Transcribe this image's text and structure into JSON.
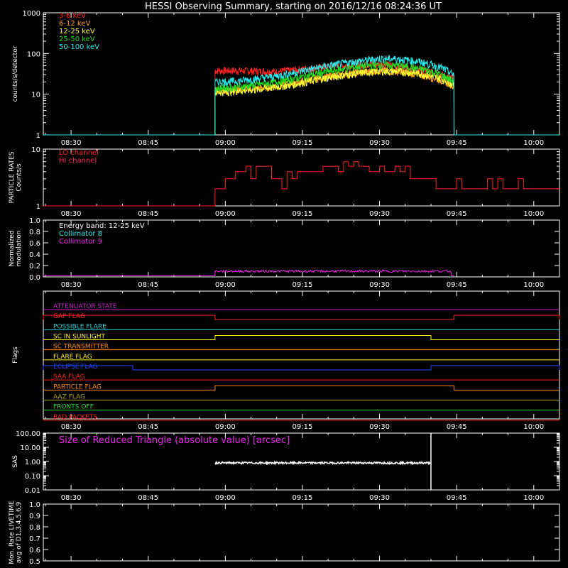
{
  "title": "HESSI Observing Summary, starting on 2016/12/16 08:24:36 UT",
  "x_tick_labels": [
    "08:30",
    "08:45",
    "09:00",
    "09:15",
    "09:30",
    "09:45",
    "10:00"
  ],
  "chart_data": [
    {
      "type": "line",
      "panel": "count-rates",
      "ylabel": "counts/s/detector",
      "yscale": "log",
      "ylim": [
        1,
        1000
      ],
      "ytick_labels": [
        "1",
        "10",
        "100",
        "1000"
      ],
      "xlim": [
        "08:24:36",
        "10:05:00"
      ],
      "data_interval": [
        "08:58:00",
        "09:44:30"
      ],
      "x": [
        "08:58",
        "09:02",
        "09:06",
        "09:10",
        "09:14",
        "09:18",
        "09:22",
        "09:26",
        "09:30",
        "09:34",
        "09:38",
        "09:42",
        "09:44"
      ],
      "series": [
        {
          "name": "3-6 keV",
          "color": "#ff2020",
          "values": [
            38,
            38,
            37,
            36,
            40,
            45,
            50,
            53,
            55,
            48,
            40,
            30,
            25
          ]
        },
        {
          "name": "6-12 keV",
          "color": "#ff9a1a",
          "values": [
            12,
            13,
            14,
            16,
            20,
            25,
            30,
            35,
            38,
            36,
            30,
            22,
            17
          ]
        },
        {
          "name": "12-25 keV",
          "color": "#ffff33",
          "values": [
            11,
            12,
            13,
            15,
            18,
            23,
            28,
            33,
            37,
            36,
            32,
            24,
            18
          ]
        },
        {
          "name": "25-50 keV",
          "color": "#22dd22",
          "values": [
            14,
            15,
            17,
            20,
            25,
            32,
            40,
            48,
            53,
            50,
            42,
            30,
            22
          ]
        },
        {
          "name": "50-100 keV",
          "color": "#22eeee",
          "values": [
            20,
            21,
            24,
            28,
            35,
            45,
            55,
            65,
            75,
            73,
            62,
            45,
            32
          ]
        }
      ]
    },
    {
      "type": "line",
      "panel": "particle-rates",
      "ylabel": "PARTICLE RATES\nCounts/s",
      "yscale": "log",
      "ylim": [
        1,
        10
      ],
      "ytick_labels": [
        "1",
        "10"
      ],
      "series": [
        {
          "name": "LO channel",
          "color": "#ff2020",
          "values": [
            1,
            4,
            4,
            3,
            4,
            4,
            5,
            5,
            4,
            4,
            3,
            2,
            2
          ]
        },
        {
          "name": "HI channel",
          "color": "#ff2060",
          "values": []
        }
      ]
    },
    {
      "type": "line",
      "panel": "modulation",
      "ylabel": "Normalized\nmodulation",
      "ylim": [
        0,
        1
      ],
      "ytick_labels": [
        "0.0",
        "0.2",
        "0.4",
        "0.6",
        "0.8",
        "1.0"
      ],
      "annotation": "Energy band: 12-25 keV",
      "series": [
        {
          "name": "Collimator 8",
          "color": "#22eeee",
          "values": []
        },
        {
          "name": "Collimator 9",
          "color": "#ee22ee",
          "values": [
            0.1,
            0.1,
            0.1,
            0.1,
            0.1,
            0.1,
            0.1,
            0.1,
            0.1,
            0.1,
            0.1,
            0.1,
            0.1
          ]
        }
      ]
    },
    {
      "type": "line",
      "panel": "flags",
      "ylabel": "Flags",
      "flags": [
        {
          "name": "ATTENUATOR STATE",
          "color": "#cc22cc",
          "on": []
        },
        {
          "name": "GAP FLAG",
          "color": "#ff2020",
          "on": [
            [
              "08:24:36",
              "08:58:00"
            ],
            [
              "09:44:30",
              "10:05:00"
            ]
          ]
        },
        {
          "name": "POSSIBLE FLARE",
          "color": "#22cccc",
          "on": []
        },
        {
          "name": "SC IN SUNLIGHT",
          "color": "#ffee22",
          "on": [
            [
              "08:58:00",
              "09:40:00"
            ]
          ]
        },
        {
          "name": "SC TRANSMITTER",
          "color": "#ff8811",
          "on": []
        },
        {
          "name": "FLARE FLAG",
          "color": "#ffee22",
          "on": []
        },
        {
          "name": "ECLIPSE FLAG",
          "color": "#2244ff",
          "on": [
            [
              "08:24:36",
              "08:42:00"
            ],
            [
              "09:40:00",
              "10:05:00"
            ]
          ]
        },
        {
          "name": "SAA FLAG",
          "color": "#ff2020",
          "on": []
        },
        {
          "name": "PARTICLE FLAG",
          "color": "#ff8811",
          "on": [
            [
              "08:58:00",
              "09:44:30"
            ]
          ]
        },
        {
          "name": "AAZ FLAG",
          "color": "#aaaa22",
          "on": []
        },
        {
          "name": "FRONTS OFF",
          "color": "#22dd22",
          "on": []
        },
        {
          "name": "BAD PACKETS",
          "color": "#ff2020",
          "on": []
        }
      ]
    },
    {
      "type": "line",
      "panel": "sas",
      "ylabel": "SAS",
      "yscale": "log",
      "ylim": [
        0.01,
        100
      ],
      "ytick_labels": [
        "0.01",
        "0.10",
        "1.00",
        "10.00",
        "100.00"
      ],
      "annotation": "Size of Reduced Triangle (absolute value) [arcsec]",
      "series": [
        {
          "name": "Size of Reduced Triangle",
          "color": "#ffffff",
          "values": [
            0.8,
            0.8,
            0.8,
            0.8,
            0.8,
            0.8,
            0.8,
            0.8,
            0.8,
            0.8,
            0.8
          ]
        }
      ]
    },
    {
      "type": "line",
      "panel": "livetime",
      "ylabel": "Mon. Rate LIVETIME\navg of D1,3,4,5,6,9",
      "ylim": [
        0.5,
        1.0
      ],
      "ytick_labels": [
        "0.5",
        "0.6",
        "0.7",
        "0.8",
        "0.9",
        "1.0"
      ],
      "series": []
    }
  ]
}
